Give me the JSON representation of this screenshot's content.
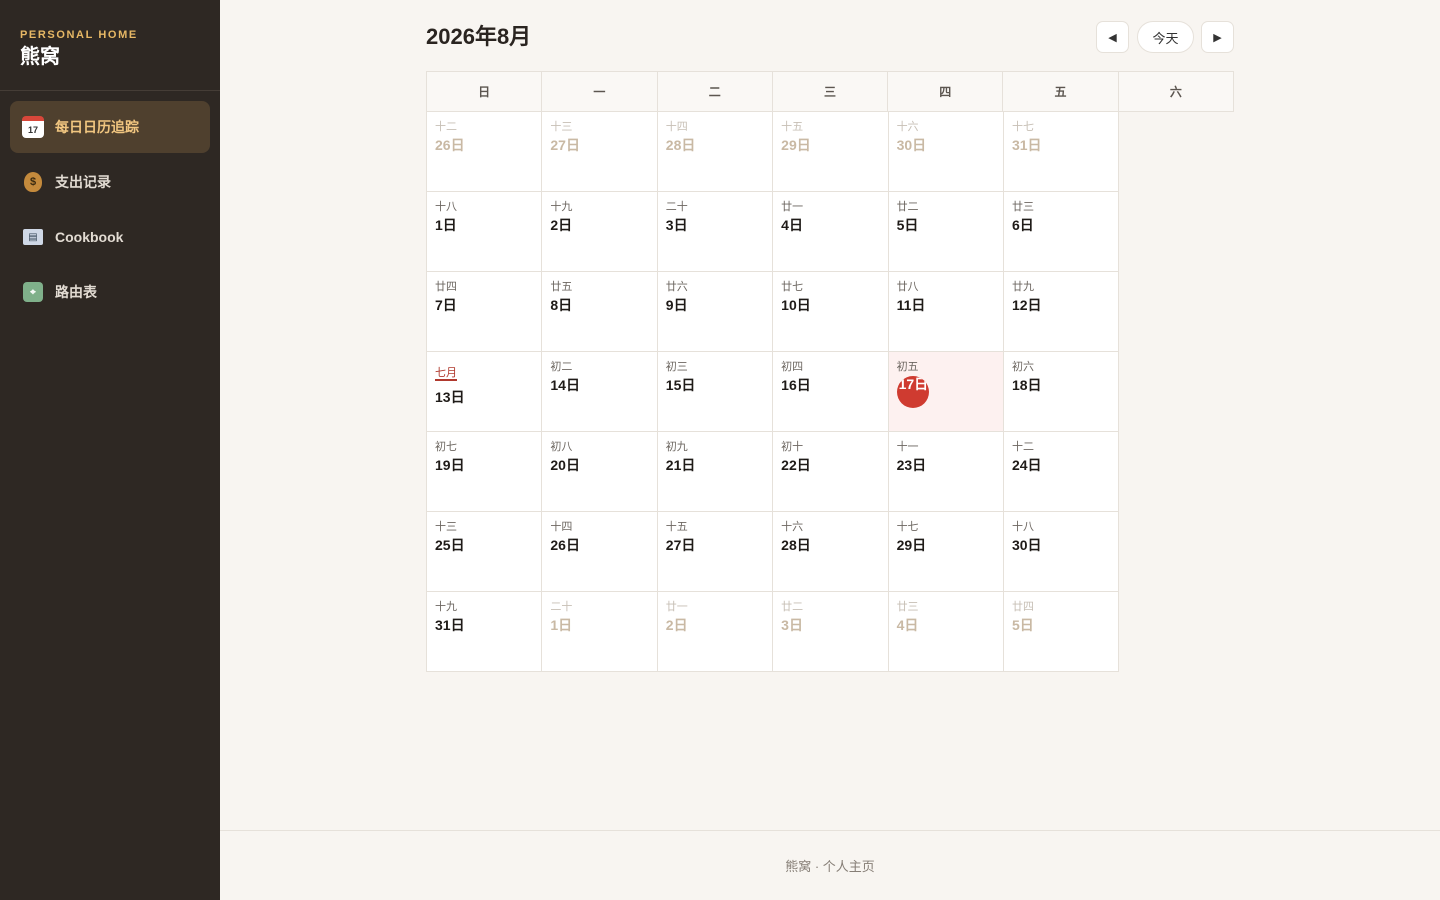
{
  "sidebar": {
    "brand_sub": "PERSONAL HOME",
    "brand_title": "熊窝",
    "items": [
      {
        "label": "每日日历追踪",
        "icon": "calendar-icon",
        "active": true
      },
      {
        "label": "支出记录",
        "icon": "money-bag-icon",
        "active": false
      },
      {
        "label": "Cookbook",
        "icon": "book-icon",
        "active": false
      },
      {
        "label": "路由表",
        "icon": "map-icon",
        "active": false
      }
    ]
  },
  "header": {
    "title": "2026年8月",
    "prev_label": "◀",
    "today_label": "今天",
    "next_label": "▶"
  },
  "calendar": {
    "weekdays": [
      "日",
      "一",
      "二",
      "三",
      "四",
      "五",
      "六"
    ],
    "weeks": [
      [
        {
          "lunar": "十二",
          "day": "26日",
          "other": true
        },
        {
          "lunar": "十三",
          "day": "27日",
          "other": true
        },
        {
          "lunar": "十四",
          "day": "28日",
          "other": true
        },
        {
          "lunar": "十五",
          "day": "29日",
          "other": true
        },
        {
          "lunar": "十六",
          "day": "30日",
          "other": true
        },
        {
          "lunar": "十七",
          "day": "31日",
          "other": true
        },
        {
          "lunar": "十八",
          "day": "1日"
        }
      ],
      [
        {
          "lunar": "十九",
          "day": "2日"
        },
        {
          "lunar": "二十",
          "day": "3日"
        },
        {
          "lunar": "廿一",
          "day": "4日"
        },
        {
          "lunar": "廿二",
          "day": "5日"
        },
        {
          "lunar": "廿三",
          "day": "6日"
        },
        {
          "lunar": "廿四",
          "day": "7日"
        },
        {
          "lunar": "廿五",
          "day": "8日"
        }
      ],
      [
        {
          "lunar": "廿六",
          "day": "9日"
        },
        {
          "lunar": "廿七",
          "day": "10日"
        },
        {
          "lunar": "廿八",
          "day": "11日"
        },
        {
          "lunar": "廿九",
          "day": "12日"
        },
        {
          "lunar": "七月",
          "day": "13日",
          "festival": true
        },
        {
          "lunar": "初二",
          "day": "14日"
        },
        {
          "lunar": "初三",
          "day": "15日"
        }
      ],
      [
        {
          "lunar": "初四",
          "day": "16日"
        },
        {
          "lunar": "初五",
          "day": "17日",
          "today": true
        },
        {
          "lunar": "初六",
          "day": "18日"
        },
        {
          "lunar": "初七",
          "day": "19日"
        },
        {
          "lunar": "初八",
          "day": "20日"
        },
        {
          "lunar": "初九",
          "day": "21日"
        },
        {
          "lunar": "初十",
          "day": "22日"
        }
      ],
      [
        {
          "lunar": "十一",
          "day": "23日"
        },
        {
          "lunar": "十二",
          "day": "24日"
        },
        {
          "lunar": "十三",
          "day": "25日"
        },
        {
          "lunar": "十四",
          "day": "26日"
        },
        {
          "lunar": "十五",
          "day": "27日"
        },
        {
          "lunar": "十六",
          "day": "28日"
        },
        {
          "lunar": "十七",
          "day": "29日"
        }
      ],
      [
        {
          "lunar": "十八",
          "day": "30日"
        },
        {
          "lunar": "十九",
          "day": "31日"
        },
        {
          "lunar": "二十",
          "day": "1日",
          "other": true
        },
        {
          "lunar": "廿一",
          "day": "2日",
          "other": true
        },
        {
          "lunar": "廿二",
          "day": "3日",
          "other": true
        },
        {
          "lunar": "廿三",
          "day": "4日",
          "other": true
        },
        {
          "lunar": "廿四",
          "day": "5日",
          "other": true
        }
      ]
    ]
  },
  "footer": {
    "text": "熊窝 · 个人主页"
  },
  "colors": {
    "sidebar_bg": "#2e2823",
    "accent_gold": "#e7b865",
    "today_red": "#cf3b30"
  }
}
